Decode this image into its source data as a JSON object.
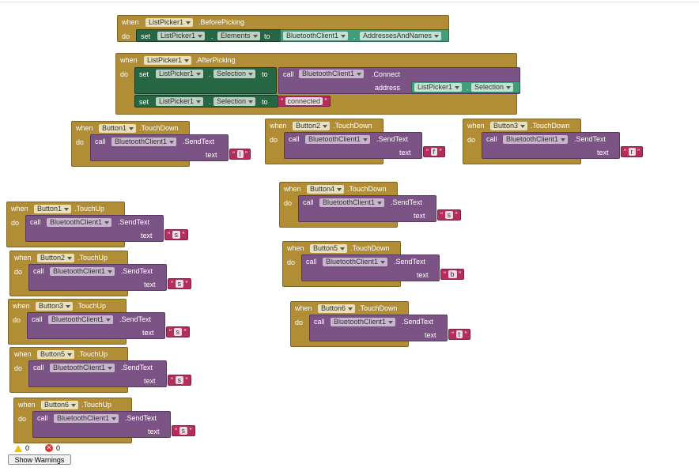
{
  "keywords": {
    "when": "when",
    "do": "do",
    "set": "set",
    "to": "to",
    "call": "call",
    "text": "text",
    "address": "address"
  },
  "picker_before": {
    "component": "ListPicker1",
    "event": ".BeforePicking",
    "set_target": "ListPicker1",
    "set_prop": "Elements",
    "value_component": "BluetoothClient1",
    "value_prop": "AddressesAndNames"
  },
  "picker_after": {
    "component": "ListPicker1",
    "event": ".AfterPicking",
    "set1_target": "ListPicker1",
    "set1_prop": "Selection",
    "call_component": "BluetoothClient1",
    "call_method": ".Connect",
    "address_component": "ListPicker1",
    "address_prop": "Selection",
    "set2_target": "ListPicker1",
    "set2_prop": "Selection",
    "set2_text": "connected"
  },
  "sendtext": {
    "component": "BluetoothClient1",
    "method": ".SendText"
  },
  "events": [
    {
      "component": "Button1",
      "event": ".TouchDown",
      "value": "l"
    },
    {
      "component": "Button2",
      "event": ".TouchDown",
      "value": "f"
    },
    {
      "component": "Button3",
      "event": ".TouchDown",
      "value": "r"
    },
    {
      "component": "Button4",
      "event": ".TouchDown",
      "value": "s"
    },
    {
      "component": "Button5",
      "event": ".TouchDown",
      "value": "b"
    },
    {
      "component": "Button6",
      "event": ".TouchDown",
      "value": "t"
    },
    {
      "component": "Button1",
      "event": ".TouchUp",
      "value": "s"
    },
    {
      "component": "Button2",
      "event": ".TouchUp",
      "value": "s"
    },
    {
      "component": "Button3",
      "event": ".TouchUp",
      "value": "s"
    },
    {
      "component": "Button5",
      "event": ".TouchUp",
      "value": "s"
    },
    {
      "component": "Button6",
      "event": ".TouchUp",
      "value": "s"
    }
  ],
  "warnings": {
    "warning_count": "0",
    "error_count": "0",
    "show_warnings_label": "Show Warnings"
  },
  "colors": {
    "event_block": "#b18e35",
    "procedure_call": "#7c5385",
    "setter": "#266643",
    "getter": "#449d79",
    "text": "#b32d5e"
  },
  "icons": {
    "warning": "warning-triangle-icon",
    "error": "error-circle-icon",
    "dropdown": "chevron-down-icon"
  }
}
